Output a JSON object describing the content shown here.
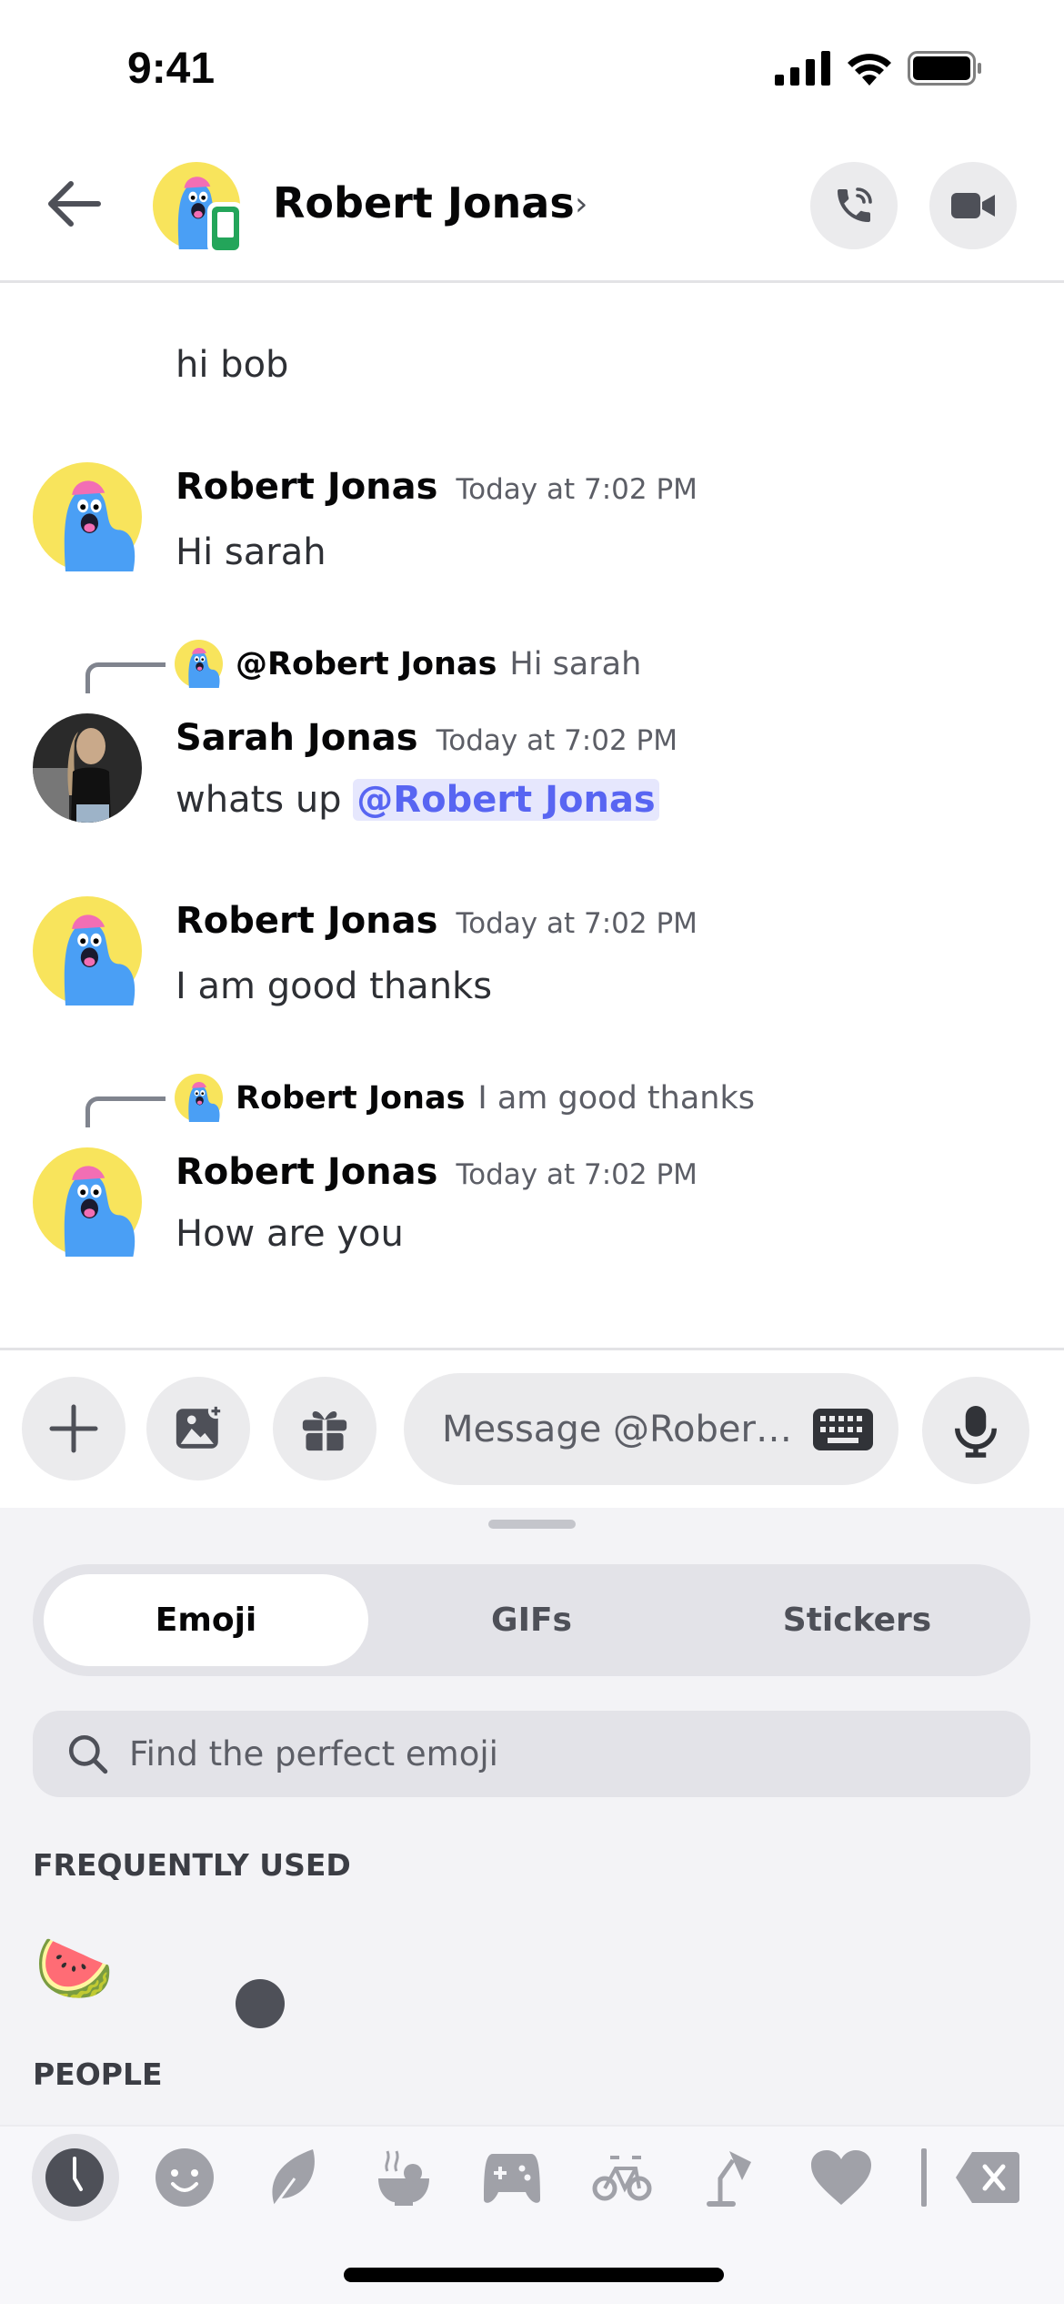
{
  "status_bar": {
    "time": "9:41"
  },
  "header": {
    "title": "Robert Jonas",
    "chevron": "›"
  },
  "messages": [
    {
      "text": "hi bob"
    },
    {
      "author": "Robert Jonas",
      "timestamp": "Today at 7:02 PM",
      "text": "Hi sarah"
    },
    {
      "reply_to": "@Robert Jonas",
      "reply_text": "Hi sarah",
      "author": "Sarah Jonas",
      "timestamp": "Today at 7:02 PM",
      "text": "whats up",
      "mention": "@Robert Jonas"
    },
    {
      "author": "Robert Jonas",
      "timestamp": "Today at 7:02 PM",
      "text": "I am good thanks"
    },
    {
      "reply_to": "Robert Jonas",
      "reply_text": "I am good thanks",
      "author": "Robert Jonas",
      "timestamp": "Today at 7:02 PM",
      "text": "How are you"
    }
  ],
  "composer": {
    "placeholder": "Message @Rober…"
  },
  "picker": {
    "tabs": [
      "Emoji",
      "GIFs",
      "Stickers"
    ],
    "active_tab": "Emoji",
    "search_placeholder": "Find the perfect emoji",
    "sections": [
      "FREQUENTLY USED",
      "PEOPLE"
    ],
    "frequently_used": [
      "🍉"
    ],
    "categories": [
      "recent-clock-icon",
      "smiley-icon",
      "leaf-icon",
      "food-bowl-icon",
      "gamepad-icon",
      "bicycle-icon",
      "lamp-icon",
      "heart-icon",
      "flag-icon",
      "backspace-icon"
    ]
  },
  "colors": {
    "accent": "#5865f2",
    "mention_bg": "#e6e7fd",
    "online_mobile": "#23a55a"
  }
}
